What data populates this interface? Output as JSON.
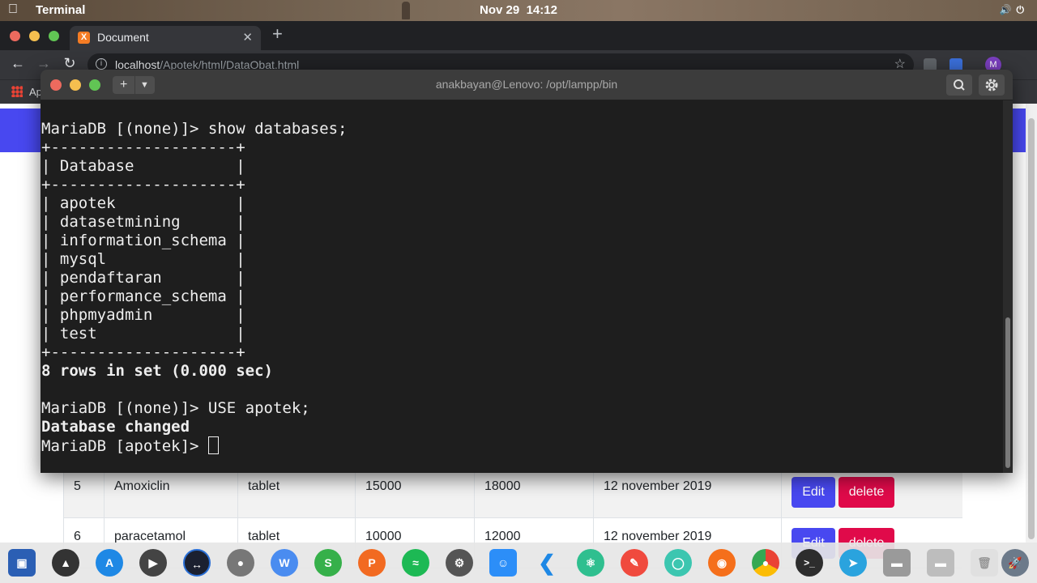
{
  "system_bar": {
    "app_name": "Terminal",
    "date": "Nov 29",
    "time": "14:12",
    "apple_glyph": ""
  },
  "browser": {
    "tab_title": "Document",
    "tab_favicon": "X",
    "url_host": "localhost",
    "url_path": "/Apotek/html/DataObat.html",
    "profile_initial": "M",
    "bookmarks_label": "Ap"
  },
  "terminal": {
    "title": "anakbayan@Lenovo: /opt/lampp/bin",
    "lines": [
      {
        "text": "MariaDB [(none)]> show databases;",
        "bold": false
      },
      {
        "text": "+--------------------+",
        "bold": false
      },
      {
        "text": "| Database           |",
        "bold": false
      },
      {
        "text": "+--------------------+",
        "bold": false
      },
      {
        "text": "| apotek             |",
        "bold": false
      },
      {
        "text": "| datasetmining      |",
        "bold": false
      },
      {
        "text": "| information_schema |",
        "bold": false
      },
      {
        "text": "| mysql              |",
        "bold": false
      },
      {
        "text": "| pendaftaran        |",
        "bold": false
      },
      {
        "text": "| performance_schema |",
        "bold": false
      },
      {
        "text": "| phpmyadmin         |",
        "bold": false
      },
      {
        "text": "| test               |",
        "bold": false
      },
      {
        "text": "+--------------------+",
        "bold": false
      },
      {
        "text": "8 rows in set (0.000 sec)",
        "bold": true
      },
      {
        "text": "",
        "bold": false
      },
      {
        "text": "MariaDB [(none)]> USE apotek;",
        "bold": false
      },
      {
        "text": "Database changed",
        "bold": true
      }
    ],
    "prompt": "MariaDB [apotek]> "
  },
  "table": {
    "rows": [
      {
        "no": "5",
        "name": "Amoxiclin",
        "type": "tablet",
        "buy": "15000",
        "sell": "18000",
        "date": "12 november 2019"
      },
      {
        "no": "6",
        "name": "paracetamol",
        "type": "tablet",
        "buy": "10000",
        "sell": "12000",
        "date": "12 november 2019"
      }
    ],
    "edit_label": "Edit",
    "delete_label": "delete"
  },
  "colors": {
    "accent_blue": "#4848f0",
    "delete_red": "#e00a4a",
    "terminal_bg": "#1e1e1e"
  },
  "dock_icons": [
    "screenshot-app-icon",
    "inkscape-icon",
    "app-store-icon",
    "video-player-icon",
    "remote-desktop-icon",
    "toggle-app-icon",
    "wps-writer-icon",
    "wps-spreadsheet-icon",
    "wps-presentation-icon",
    "spotify-icon",
    "settings-icon",
    "finder-icon",
    "vscode-icon",
    "atom-icon",
    "draw-icon",
    "help-lifebuoy-icon",
    "firefox-icon",
    "chrome-icon",
    "terminal-icon",
    "telegram-icon",
    "drive-icon",
    "drive-2-icon",
    "trash-icon",
    "launchpad-icon"
  ]
}
